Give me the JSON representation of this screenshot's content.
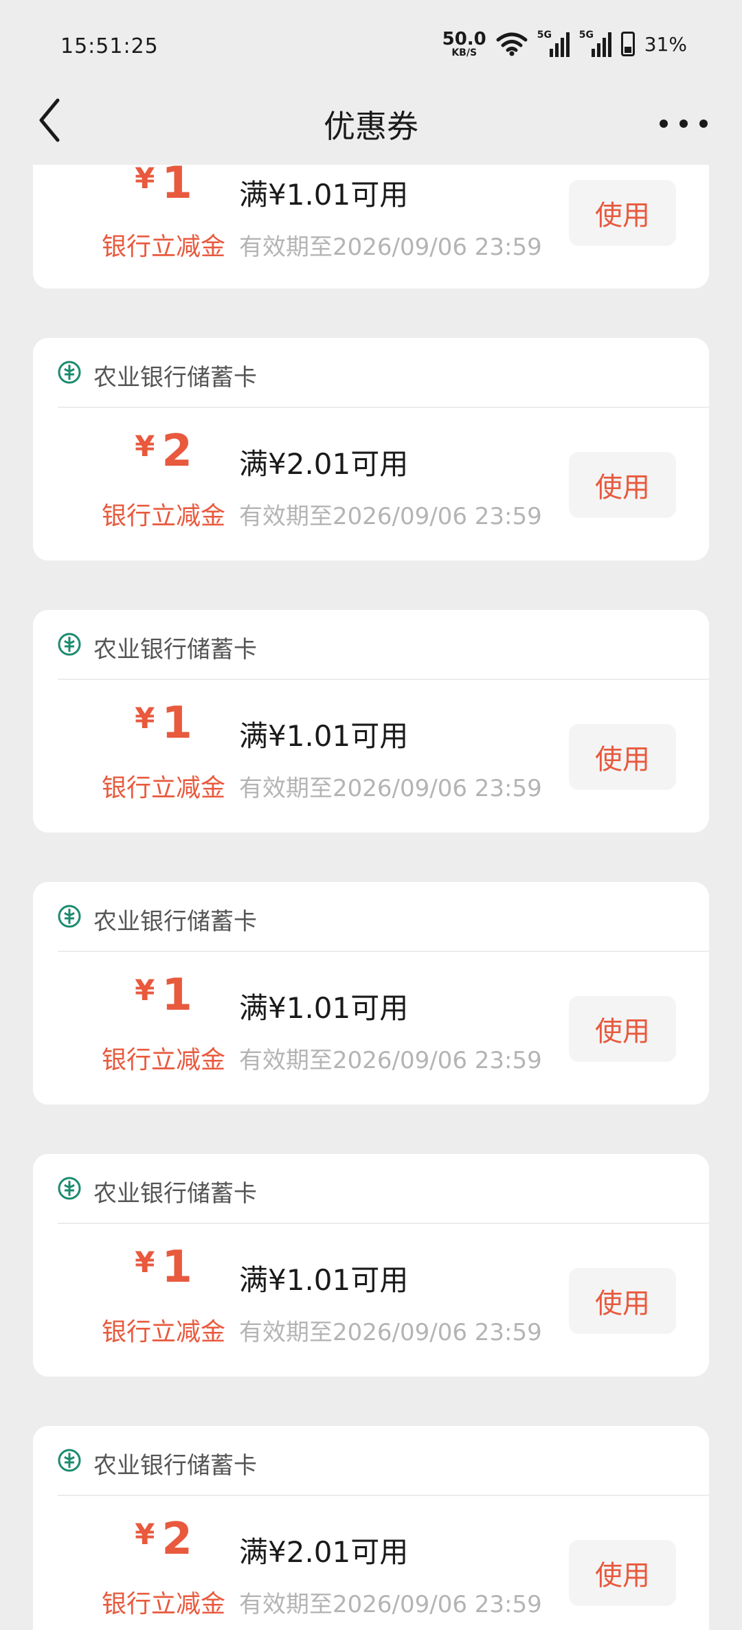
{
  "status_bar": {
    "time": "15:51:25",
    "net_speed_value": "50.0",
    "net_speed_unit": "KB/S",
    "signal1_tag": "5G",
    "signal2_tag": "5G",
    "battery_percent": "31%"
  },
  "nav": {
    "title": "优惠券",
    "back_icon": "chevron-left-icon",
    "more_icon": "more-dots-icon"
  },
  "colors": {
    "accent": "#e8593d",
    "bank_green": "#1a8a6e",
    "background": "#ededed"
  },
  "coupons": [
    {
      "bank": "",
      "currency": "¥",
      "amount": "1",
      "type": "银行立减金",
      "condition": "满¥1.01可用",
      "expiry": "有效期至2026/09/06 23:59",
      "button": "使用"
    },
    {
      "bank": "农业银行储蓄卡",
      "currency": "¥",
      "amount": "2",
      "type": "银行立减金",
      "condition": "满¥2.01可用",
      "expiry": "有效期至2026/09/06 23:59",
      "button": "使用"
    },
    {
      "bank": "农业银行储蓄卡",
      "currency": "¥",
      "amount": "1",
      "type": "银行立减金",
      "condition": "满¥1.01可用",
      "expiry": "有效期至2026/09/06 23:59",
      "button": "使用"
    },
    {
      "bank": "农业银行储蓄卡",
      "currency": "¥",
      "amount": "1",
      "type": "银行立减金",
      "condition": "满¥1.01可用",
      "expiry": "有效期至2026/09/06 23:59",
      "button": "使用"
    },
    {
      "bank": "农业银行储蓄卡",
      "currency": "¥",
      "amount": "1",
      "type": "银行立减金",
      "condition": "满¥1.01可用",
      "expiry": "有效期至2026/09/06 23:59",
      "button": "使用"
    },
    {
      "bank": "农业银行储蓄卡",
      "currency": "¥",
      "amount": "2",
      "type": "银行立减金",
      "condition": "满¥2.01可用",
      "expiry": "有效期至2026/09/06 23:59",
      "button": "使用"
    }
  ]
}
